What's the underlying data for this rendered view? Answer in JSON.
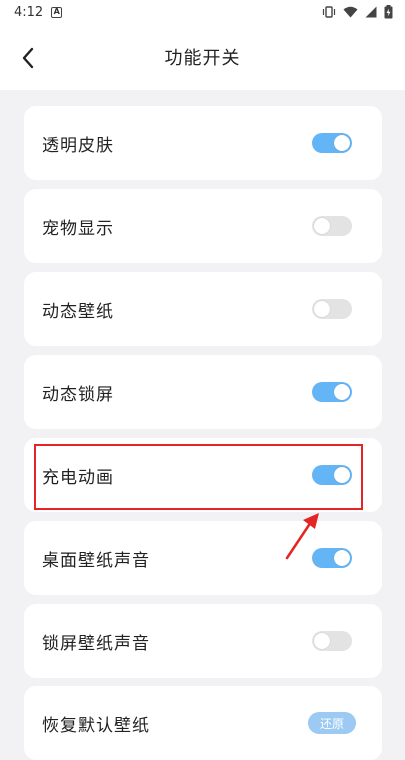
{
  "status_bar": {
    "time": "4:12",
    "app_badge": "A"
  },
  "header": {
    "title": "功能开关",
    "back_icon": "chevron-left-icon"
  },
  "settings": [
    {
      "label": "透明皮肤",
      "enabled": true
    },
    {
      "label": "宠物显示",
      "enabled": false
    },
    {
      "label": "动态壁纸",
      "enabled": false
    },
    {
      "label": "动态锁屏",
      "enabled": true
    },
    {
      "label": "充电动画",
      "enabled": true
    },
    {
      "label": "桌面壁纸声音",
      "enabled": true
    },
    {
      "label": "锁屏壁纸声音",
      "enabled": false
    }
  ],
  "restore_row": {
    "label": "恢复默认壁纸",
    "button_label": "还原"
  },
  "colors": {
    "toggle_on": "#64b5f6",
    "toggle_off": "#e3e3e3",
    "highlight": "#e32525",
    "background": "#f2f2f4"
  }
}
